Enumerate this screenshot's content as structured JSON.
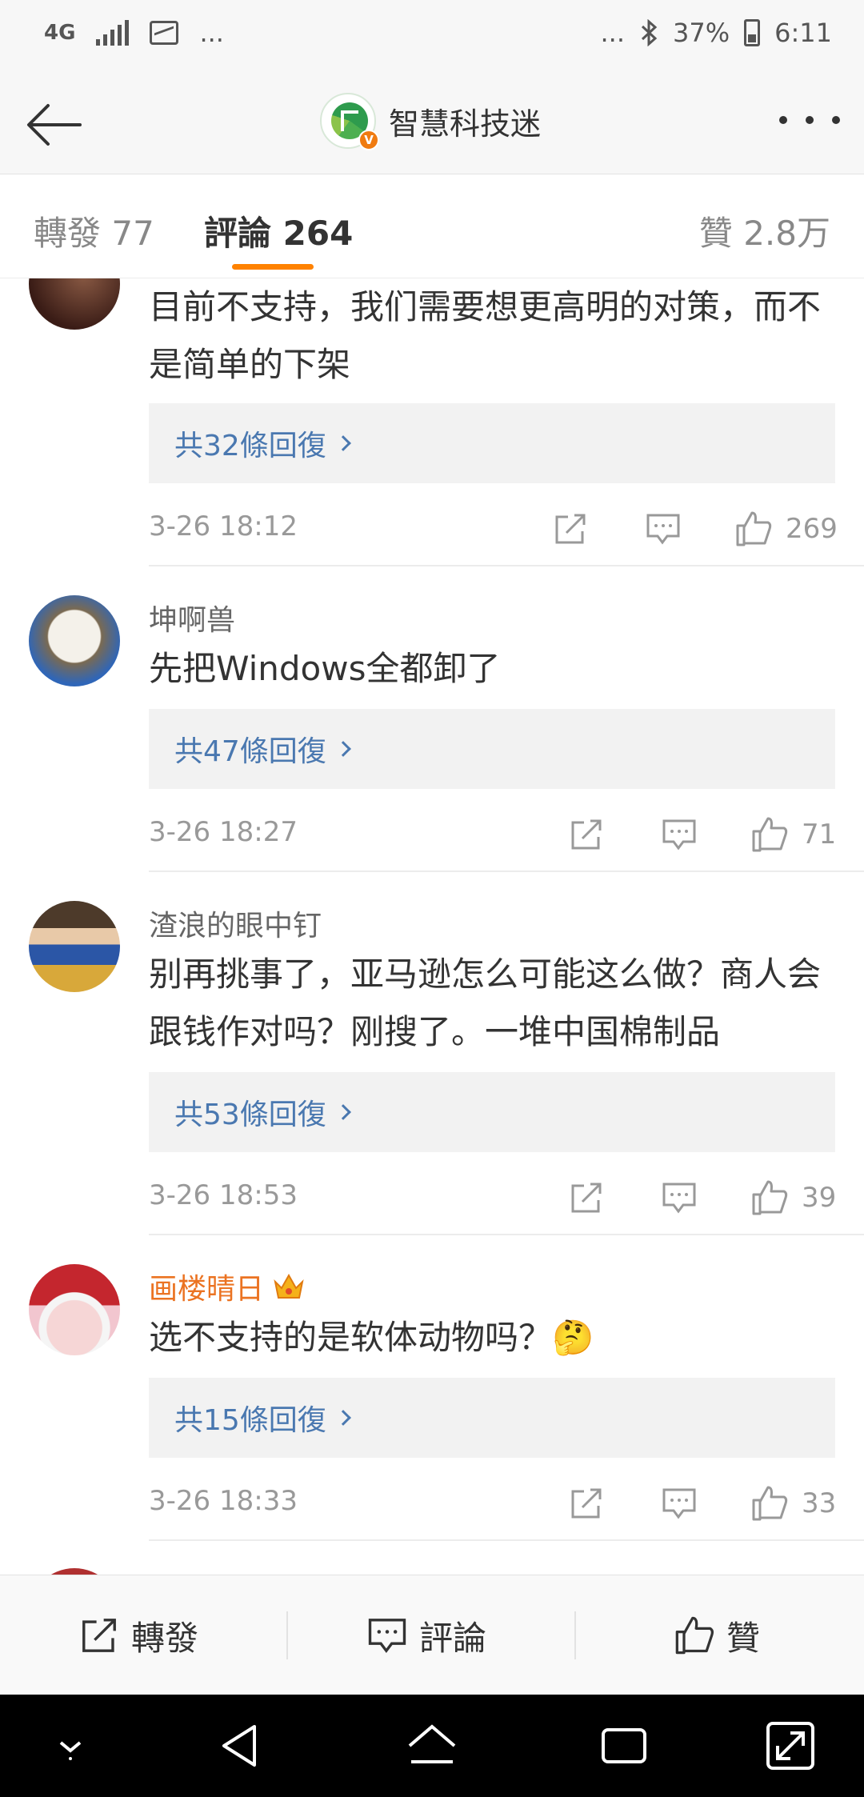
{
  "status_bar": {
    "network": "4G",
    "more": "...",
    "more2": "...",
    "battery": "37%",
    "time": "6:11"
  },
  "header": {
    "title": "智慧科技迷",
    "verified_mark": "V",
    "back_icon": "arrow-left-icon",
    "more_icon": "more-dots-icon"
  },
  "tabs": {
    "forward": "轉發 77",
    "comments": "評論 264",
    "likes": "贊 2.8万"
  },
  "comments": [
    {
      "username": "",
      "text": "目前不支持，我们需要想更高明的对策，而不是简单的下架",
      "replies": "共32條回復",
      "time": "3-26 18:12",
      "likes": "269"
    },
    {
      "username": "坤啊兽",
      "text": "先把Windows全都卸了",
      "replies": "共47條回復",
      "time": "3-26 18:27",
      "likes": "71"
    },
    {
      "username": "渣浪的眼中钉",
      "text": "别再挑事了，亚马逊怎么可能这么做？商人会跟钱作对吗？刚搜了。一堆中国棉制品",
      "replies": "共53條回復",
      "time": "3-26 18:53",
      "likes": "39"
    },
    {
      "username": "画楼晴日",
      "text": "选不支持的是软体动物吗？🤔",
      "replies": "共15條回復",
      "time": "3-26 18:33",
      "likes": "33"
    }
  ],
  "toolbar": {
    "forward": "轉發",
    "comment": "評論",
    "like": "贊"
  },
  "colors": {
    "accent": "#ff8200",
    "link": "#4a78b0",
    "vip_name": "#eb7322"
  }
}
